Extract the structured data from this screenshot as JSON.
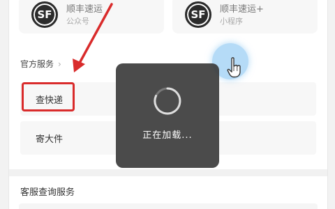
{
  "top_cards": [
    {
      "logo_text": "SF",
      "name": "顺丰速运",
      "subtitle": "公众号"
    },
    {
      "logo_text": "SF",
      "name": "顺丰速运+",
      "subtitle": "小程序"
    }
  ],
  "official_services": {
    "title": "官方服务",
    "chevron": "›",
    "items": [
      {
        "label": "查快递",
        "highlighted": true
      },
      {
        "label": "寄大件",
        "highlighted": false
      }
    ]
  },
  "customer_service": {
    "title": "客服查询服务"
  },
  "loading_toast": {
    "text": "正在加载..."
  },
  "colors": {
    "annotation_red": "#d92b2b",
    "tap_blue": "#78bef0",
    "toast_bg": "#3c3c3c"
  },
  "icons": {
    "tap": "hand-pointer-icon",
    "spinner": "loading-spinner-icon",
    "arrow": "red-arrow-annotation"
  }
}
